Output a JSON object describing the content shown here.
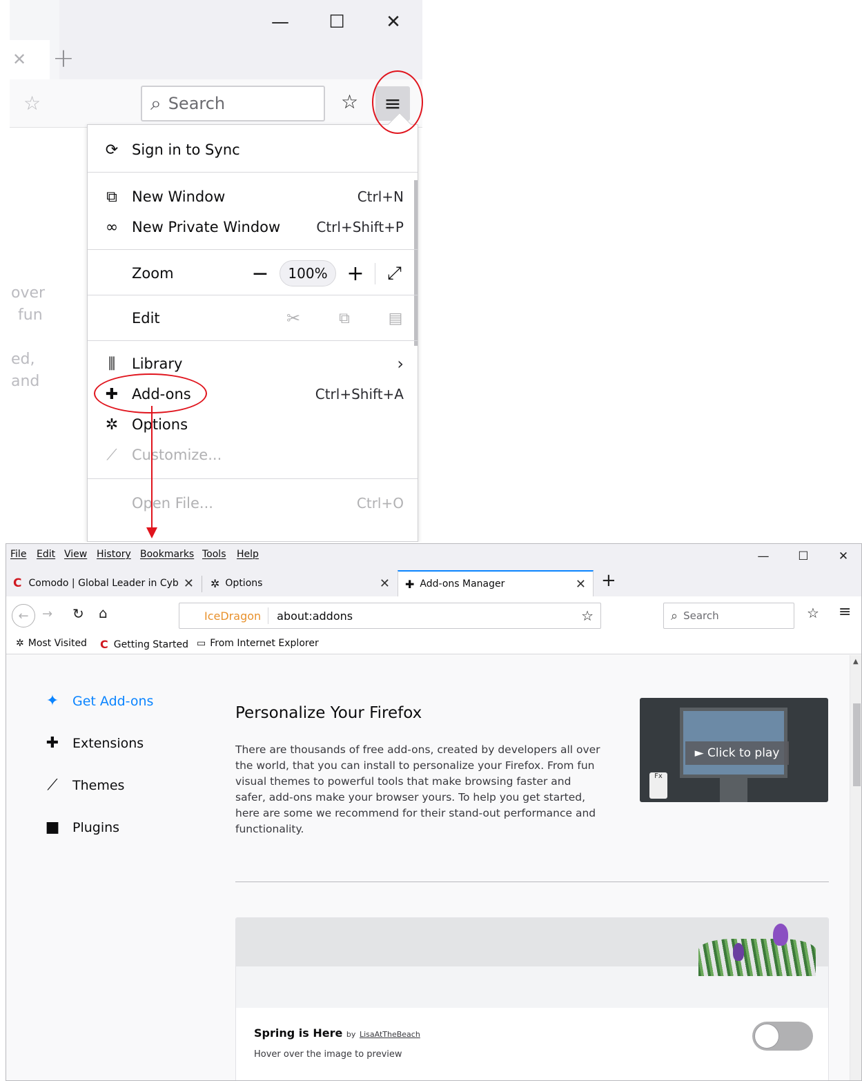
{
  "zoomed": {
    "search_placeholder": "Search",
    "window_controls": {
      "minimize": "—",
      "maximize": "☐",
      "close": "✕"
    },
    "ghost_text": [
      "over",
      "fun",
      "ed,",
      "and"
    ],
    "menu": {
      "sign_in": "Sign in to Sync",
      "new_window": {
        "label": "New Window",
        "shortcut": "Ctrl+N"
      },
      "new_private_window": {
        "label": "New Private Window",
        "shortcut": "Ctrl+Shift+P"
      },
      "zoom": {
        "label": "Zoom",
        "minus": "−",
        "value": "100%",
        "plus": "+",
        "fullscreen": "⤢"
      },
      "edit": {
        "label": "Edit"
      },
      "library": {
        "label": "Library",
        "chevron": "›"
      },
      "addons": {
        "label": "Add-ons",
        "shortcut": "Ctrl+Shift+A"
      },
      "options": {
        "label": "Options"
      },
      "customize": {
        "label": "Customize..."
      },
      "open_file": {
        "label": "Open File...",
        "shortcut": "Ctrl+O"
      }
    }
  },
  "browser": {
    "menubar": [
      "File",
      "Edit",
      "View",
      "History",
      "Bookmarks",
      "Tools",
      "Help"
    ],
    "window_controls": {
      "minimize": "—",
      "maximize": "☐",
      "close": "✕"
    },
    "tabs": [
      {
        "label": "Comodo | Global Leader in Cyb",
        "close": "✕"
      },
      {
        "label": "Options",
        "close": "✕"
      },
      {
        "label": "Add-ons Manager",
        "close": "✕"
      }
    ],
    "new_tab": "+",
    "identity": "IceDragon",
    "url": "about:addons",
    "search_placeholder": "Search",
    "bookmarks": [
      "Most Visited",
      "Getting Started",
      "From Internet Explorer"
    ],
    "categories": [
      "Get Add-ons",
      "Extensions",
      "Themes",
      "Plugins"
    ],
    "discover": {
      "title": "Personalize Your Firefox",
      "body": "There are thousands of free add-ons, created by developers all over the world, that you can install to personalize your Firefox. From fun visual themes to powerful tools that make browsing faster and safer, add-ons make your browser yours. To help you get started, here are some we recommend for their stand-out performance and functionality.",
      "video_label": "► Click to play"
    },
    "theme_card": {
      "title": "Spring is Here",
      "by": "by",
      "author": "LisaAtTheBeach",
      "hint": "Hover over the image to preview",
      "enabled": false
    }
  },
  "colors": {
    "accent": "#0a84ff",
    "annotation": "#e0141d",
    "identity": "#e8912c"
  }
}
